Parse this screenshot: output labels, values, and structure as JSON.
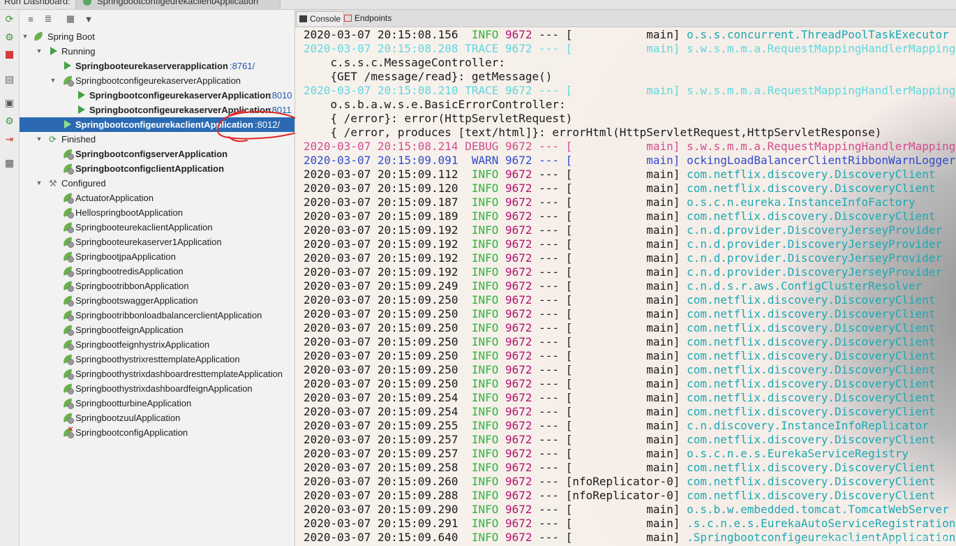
{
  "topbar": {
    "title": "Run Dashboard:",
    "active_tab": "SpringbootconfigeurekaclientApplication"
  },
  "console_tabs": [
    "Console",
    "Endpoints"
  ],
  "tree": {
    "root": "Spring Boot",
    "groups": {
      "running": "Running",
      "finished": "Finished",
      "configured": "Configured"
    },
    "rows": [
      {
        "label": "Springbooteurekaserverapplication",
        "port": ":8761/"
      },
      {
        "label": "SpringbootconfigeurekaserverApplication",
        "port": ""
      },
      {
        "label": "SpringbootconfigeurekaserverApplication",
        "port": ":8010"
      },
      {
        "label": "SpringbootconfigeurekaserverApplication",
        "port": ":8011"
      },
      {
        "label": "SpringbootconfigeurekaclientApplication",
        "port": ":8012/"
      },
      {
        "label": "SpringbootconfigserverApplication",
        "port": ""
      },
      {
        "label": "SpringbootconfigclientApplication",
        "port": ""
      },
      {
        "label": "ActuatorApplication",
        "port": ""
      },
      {
        "label": "HellospringbootApplication",
        "port": ""
      },
      {
        "label": "SpringbooteurekaclientApplication",
        "port": ""
      },
      {
        "label": "Springbooteurekaserver1Application",
        "port": ""
      },
      {
        "label": "SpringbootjpaApplication",
        "port": ""
      },
      {
        "label": "SpringbootredisApplication",
        "port": ""
      },
      {
        "label": "SpringbootribbonApplication",
        "port": ""
      },
      {
        "label": "SpringbootswaggerApplication",
        "port": ""
      },
      {
        "label": "SpringbootribbonloadbalancerclientApplication",
        "port": ""
      },
      {
        "label": "SpringbootfeignApplication",
        "port": ""
      },
      {
        "label": "SpringbootfeignhystrixApplication",
        "port": ""
      },
      {
        "label": "SpringboothystrixresttemplateApplication",
        "port": ""
      },
      {
        "label": "SpringboothystrixdashboardresttemplateApplication",
        "port": ""
      },
      {
        "label": "SpringboothystrixdashboardfeignApplication",
        "port": ""
      },
      {
        "label": "SpringbootturbineApplication",
        "port": ""
      },
      {
        "label": "SpringbootzuulApplication",
        "port": ""
      },
      {
        "label": "SpringbootconfigApplication",
        "port": ""
      }
    ]
  },
  "console": {
    "lines": [
      {
        "text": "2020-03-07 20:15:08.156  INFO 9672 --- [           main] o.s.s.concurrent.ThreadPoolTaskExecutor",
        "kind": "info"
      },
      {
        "text": "2020-03-07 20:15:08.208 TRACE 9672 --- [           main] s.w.s.m.m.a.RequestMappingHandlerMapping",
        "kind": "trace"
      },
      {
        "text": "    c.s.s.c.MessageController:",
        "kind": "plain"
      },
      {
        "text": "    {GET /message/read}: getMessage()",
        "kind": "plain"
      },
      {
        "text": "2020-03-07 20:15:08.210 TRACE 9672 --- [           main] s.w.s.m.m.a.RequestMappingHandlerMapping",
        "kind": "trace"
      },
      {
        "text": "    o.s.b.a.w.s.e.BasicErrorController:",
        "kind": "plain"
      },
      {
        "text": "    { /error}: error(HttpServletRequest)",
        "kind": "plain"
      },
      {
        "text": "    { /error, produces [text/html]}: errorHtml(HttpServletRequest,HttpServletResponse)",
        "kind": "plain"
      },
      {
        "text": "2020-03-07 20:15:08.214 DEBUG 9672 --- [           main] s.w.s.m.m.a.RequestMappingHandlerMapping",
        "kind": "debug"
      },
      {
        "text": "2020-03-07 20:15:09.091  WARN 9672 --- [           main] ockingLoadBalancerClientRibbonWarnLogger",
        "kind": "warn"
      },
      {
        "text": "2020-03-07 20:15:09.112  INFO 9672 --- [           main] com.netflix.discovery.DiscoveryClient",
        "kind": "info"
      },
      {
        "text": "2020-03-07 20:15:09.120  INFO 9672 --- [           main] com.netflix.discovery.DiscoveryClient",
        "kind": "info"
      },
      {
        "text": "2020-03-07 20:15:09.187  INFO 9672 --- [           main] o.s.c.n.eureka.InstanceInfoFactory",
        "kind": "info"
      },
      {
        "text": "2020-03-07 20:15:09.189  INFO 9672 --- [           main] com.netflix.discovery.DiscoveryClient",
        "kind": "info"
      },
      {
        "text": "2020-03-07 20:15:09.192  INFO 9672 --- [           main] c.n.d.provider.DiscoveryJerseyProvider",
        "kind": "info"
      },
      {
        "text": "2020-03-07 20:15:09.192  INFO 9672 --- [           main] c.n.d.provider.DiscoveryJerseyProvider",
        "kind": "info"
      },
      {
        "text": "2020-03-07 20:15:09.192  INFO 9672 --- [           main] c.n.d.provider.DiscoveryJerseyProvider",
        "kind": "info"
      },
      {
        "text": "2020-03-07 20:15:09.192  INFO 9672 --- [           main] c.n.d.provider.DiscoveryJerseyProvider",
        "kind": "info"
      },
      {
        "text": "2020-03-07 20:15:09.249  INFO 9672 --- [           main] c.n.d.s.r.aws.ConfigClusterResolver",
        "kind": "info"
      },
      {
        "text": "2020-03-07 20:15:09.250  INFO 9672 --- [           main] com.netflix.discovery.DiscoveryClient",
        "kind": "info"
      },
      {
        "text": "2020-03-07 20:15:09.250  INFO 9672 --- [           main] com.netflix.discovery.DiscoveryClient",
        "kind": "info"
      },
      {
        "text": "2020-03-07 20:15:09.250  INFO 9672 --- [           main] com.netflix.discovery.DiscoveryClient",
        "kind": "info"
      },
      {
        "text": "2020-03-07 20:15:09.250  INFO 9672 --- [           main] com.netflix.discovery.DiscoveryClient",
        "kind": "info"
      },
      {
        "text": "2020-03-07 20:15:09.250  INFO 9672 --- [           main] com.netflix.discovery.DiscoveryClient",
        "kind": "info"
      },
      {
        "text": "2020-03-07 20:15:09.250  INFO 9672 --- [           main] com.netflix.discovery.DiscoveryClient",
        "kind": "info"
      },
      {
        "text": "2020-03-07 20:15:09.250  INFO 9672 --- [           main] com.netflix.discovery.DiscoveryClient",
        "kind": "info"
      },
      {
        "text": "2020-03-07 20:15:09.254  INFO 9672 --- [           main] com.netflix.discovery.DiscoveryClient",
        "kind": "info"
      },
      {
        "text": "2020-03-07 20:15:09.254  INFO 9672 --- [           main] com.netflix.discovery.DiscoveryClient",
        "kind": "info"
      },
      {
        "text": "2020-03-07 20:15:09.255  INFO 9672 --- [           main] c.n.discovery.InstanceInfoReplicator",
        "kind": "info"
      },
      {
        "text": "2020-03-07 20:15:09.257  INFO 9672 --- [           main] com.netflix.discovery.DiscoveryClient",
        "kind": "info"
      },
      {
        "text": "2020-03-07 20:15:09.257  INFO 9672 --- [           main] o.s.c.n.e.s.EurekaServiceRegistry",
        "kind": "info"
      },
      {
        "text": "2020-03-07 20:15:09.258  INFO 9672 --- [           main] com.netflix.discovery.DiscoveryClient",
        "kind": "info"
      },
      {
        "text": "2020-03-07 20:15:09.260  INFO 9672 --- [nfoReplicator-0] com.netflix.discovery.DiscoveryClient",
        "kind": "info"
      },
      {
        "text": "2020-03-07 20:15:09.288  INFO 9672 --- [nfoReplicator-0] com.netflix.discovery.DiscoveryClient",
        "kind": "info"
      },
      {
        "text": "2020-03-07 20:15:09.290  INFO 9672 --- [           main] o.s.b.w.embedded.tomcat.TomcatWebServer",
        "kind": "info"
      },
      {
        "text": "2020-03-07 20:15:09.291  INFO 9672 --- [           main] .s.c.n.e.s.EurekaAutoServiceRegistration",
        "kind": "info"
      },
      {
        "text": "2020-03-07 20:15:09.640  INFO 9672 --- [           main] .SpringbootconfigeurekaclientApplication",
        "kind": "info"
      }
    ]
  },
  "colors": {
    "selection": "#2b6ab3",
    "info": "#2fb43c",
    "pid": "#b3126f",
    "logger": "#1aa9b4",
    "annotation": "#e02828"
  },
  "watermark": "https://blog.csdn.net/u018792/21831"
}
